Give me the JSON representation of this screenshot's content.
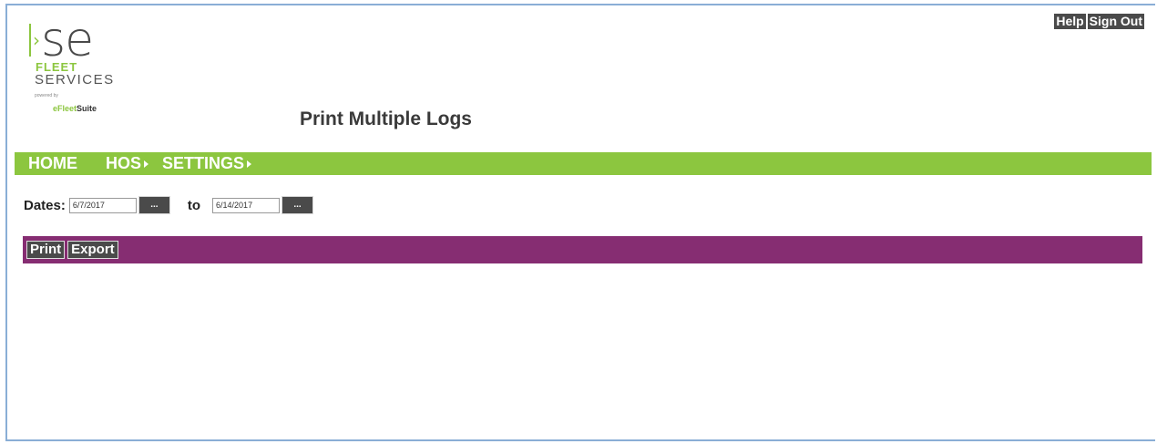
{
  "logo": {
    "mark": "se",
    "chevron": "›",
    "line1": "FLEET",
    "line2": "SERVICES",
    "powered_by": "powered by",
    "product_e": "e",
    "product_fleet": "Fleet",
    "product_suite": "Suite"
  },
  "header": {
    "title": "Print Multiple Logs",
    "links": [
      {
        "label": "Help"
      },
      {
        "label": "Sign Out"
      }
    ]
  },
  "nav": {
    "items": [
      {
        "label": "HOME",
        "has_submenu": false
      },
      {
        "label": "HOS",
        "has_submenu": true
      },
      {
        "label": "SETTINGS",
        "has_submenu": true
      }
    ],
    "color": "#8cc63f"
  },
  "dates": {
    "label": "Dates:",
    "start_value": "6/7/2017",
    "picker_label": "...",
    "to_label": "to",
    "end_value": "6/14/2017"
  },
  "actions": {
    "bar_color": "#862d72",
    "print_label": "Print",
    "export_label": "Export"
  }
}
